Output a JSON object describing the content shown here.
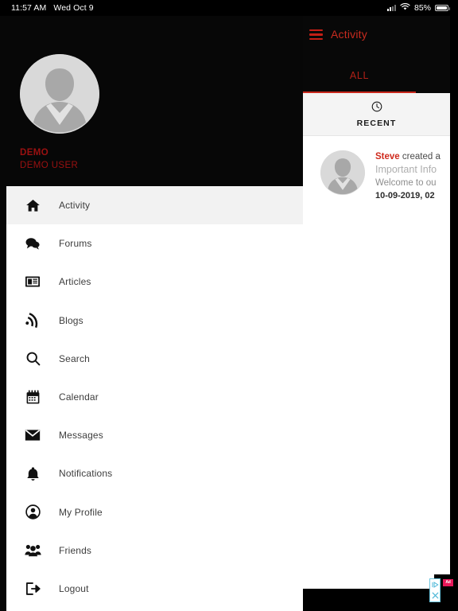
{
  "status_bar": {
    "time": "11:57 AM",
    "date": "Wed Oct 9",
    "battery_percent": "85%",
    "signal_icon": "cellular-bars-icon",
    "wifi_icon": "wifi-icon",
    "battery_icon": "battery-icon"
  },
  "drawer": {
    "avatar_icon": "user-avatar-placeholder",
    "user_name": "DEMO",
    "user_fullname": "DEMO USER",
    "accent_color": "#9b1111",
    "items": [
      {
        "label": "Activity",
        "icon": "home-icon",
        "active": true
      },
      {
        "label": "Forums",
        "icon": "chat-bubbles-icon",
        "active": false
      },
      {
        "label": "Articles",
        "icon": "newspaper-icon",
        "active": false
      },
      {
        "label": "Blogs",
        "icon": "rss-icon",
        "active": false
      },
      {
        "label": "Search",
        "icon": "search-icon",
        "active": false
      },
      {
        "label": "Calendar",
        "icon": "calendar-icon",
        "active": false
      },
      {
        "label": "Messages",
        "icon": "envelope-icon",
        "active": false
      },
      {
        "label": "Notifications",
        "icon": "bell-icon",
        "active": false
      },
      {
        "label": "My Profile",
        "icon": "user-circle-icon",
        "active": false
      },
      {
        "label": "Friends",
        "icon": "people-group-icon",
        "active": false
      },
      {
        "label": "Logout",
        "icon": "logout-arrow-icon",
        "active": false
      }
    ]
  },
  "content": {
    "menu_icon": "hamburger-menu-icon",
    "title": "Activity",
    "title_color": "#c82b1f",
    "tabs": [
      {
        "label": "ALL",
        "selected": true
      }
    ],
    "recent_section": {
      "icon": "clock-icon",
      "label": "RECENT"
    },
    "feed": [
      {
        "avatar_icon": "user-avatar-placeholder",
        "actor": "Steve",
        "action": "created a",
        "subject": "Important Info",
        "excerpt": "Welcome to ou",
        "timestamp": "10-09-2019, 02"
      }
    ]
  },
  "ad": {
    "play_icon": "ad-play-icon",
    "close_icon": "ad-close-icon",
    "badge_label": "Ad"
  }
}
